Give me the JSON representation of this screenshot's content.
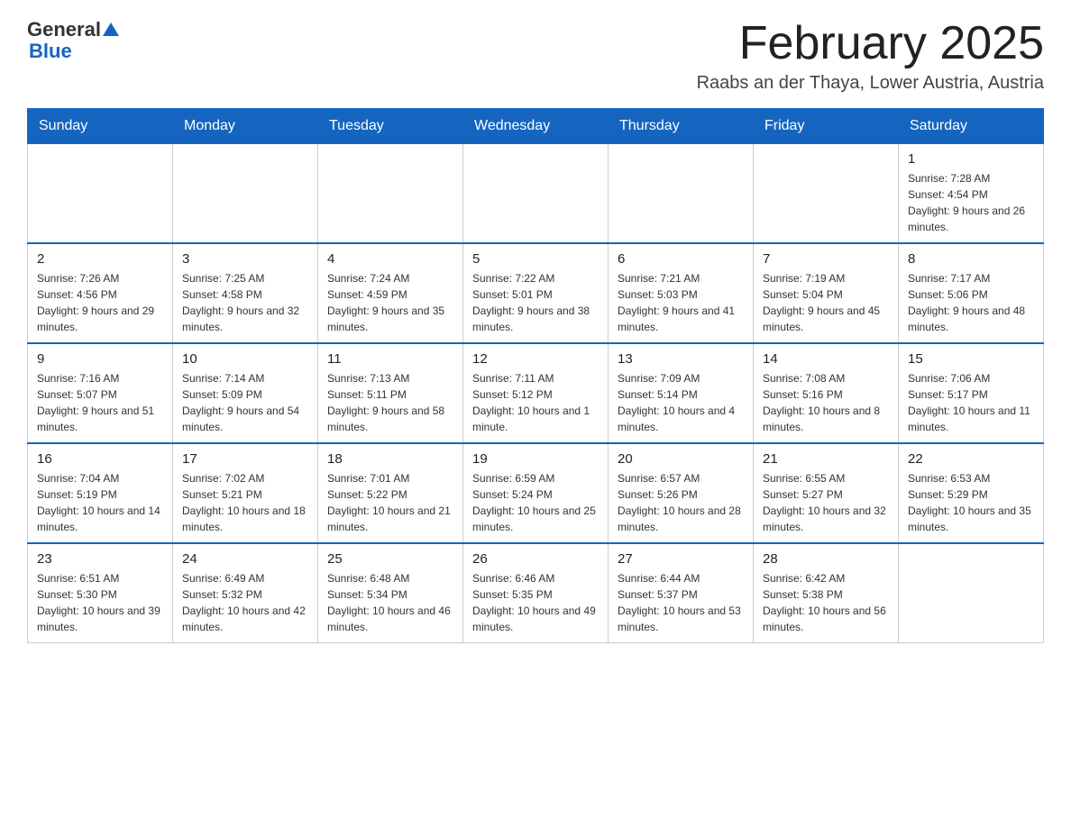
{
  "header": {
    "logo_general": "General",
    "logo_blue": "Blue",
    "title": "February 2025",
    "subtitle": "Raabs an der Thaya, Lower Austria, Austria"
  },
  "weekdays": [
    "Sunday",
    "Monday",
    "Tuesday",
    "Wednesday",
    "Thursday",
    "Friday",
    "Saturday"
  ],
  "weeks": [
    [
      {
        "day": "",
        "info": ""
      },
      {
        "day": "",
        "info": ""
      },
      {
        "day": "",
        "info": ""
      },
      {
        "day": "",
        "info": ""
      },
      {
        "day": "",
        "info": ""
      },
      {
        "day": "",
        "info": ""
      },
      {
        "day": "1",
        "info": "Sunrise: 7:28 AM\nSunset: 4:54 PM\nDaylight: 9 hours and 26 minutes."
      }
    ],
    [
      {
        "day": "2",
        "info": "Sunrise: 7:26 AM\nSunset: 4:56 PM\nDaylight: 9 hours and 29 minutes."
      },
      {
        "day": "3",
        "info": "Sunrise: 7:25 AM\nSunset: 4:58 PM\nDaylight: 9 hours and 32 minutes."
      },
      {
        "day": "4",
        "info": "Sunrise: 7:24 AM\nSunset: 4:59 PM\nDaylight: 9 hours and 35 minutes."
      },
      {
        "day": "5",
        "info": "Sunrise: 7:22 AM\nSunset: 5:01 PM\nDaylight: 9 hours and 38 minutes."
      },
      {
        "day": "6",
        "info": "Sunrise: 7:21 AM\nSunset: 5:03 PM\nDaylight: 9 hours and 41 minutes."
      },
      {
        "day": "7",
        "info": "Sunrise: 7:19 AM\nSunset: 5:04 PM\nDaylight: 9 hours and 45 minutes."
      },
      {
        "day": "8",
        "info": "Sunrise: 7:17 AM\nSunset: 5:06 PM\nDaylight: 9 hours and 48 minutes."
      }
    ],
    [
      {
        "day": "9",
        "info": "Sunrise: 7:16 AM\nSunset: 5:07 PM\nDaylight: 9 hours and 51 minutes."
      },
      {
        "day": "10",
        "info": "Sunrise: 7:14 AM\nSunset: 5:09 PM\nDaylight: 9 hours and 54 minutes."
      },
      {
        "day": "11",
        "info": "Sunrise: 7:13 AM\nSunset: 5:11 PM\nDaylight: 9 hours and 58 minutes."
      },
      {
        "day": "12",
        "info": "Sunrise: 7:11 AM\nSunset: 5:12 PM\nDaylight: 10 hours and 1 minute."
      },
      {
        "day": "13",
        "info": "Sunrise: 7:09 AM\nSunset: 5:14 PM\nDaylight: 10 hours and 4 minutes."
      },
      {
        "day": "14",
        "info": "Sunrise: 7:08 AM\nSunset: 5:16 PM\nDaylight: 10 hours and 8 minutes."
      },
      {
        "day": "15",
        "info": "Sunrise: 7:06 AM\nSunset: 5:17 PM\nDaylight: 10 hours and 11 minutes."
      }
    ],
    [
      {
        "day": "16",
        "info": "Sunrise: 7:04 AM\nSunset: 5:19 PM\nDaylight: 10 hours and 14 minutes."
      },
      {
        "day": "17",
        "info": "Sunrise: 7:02 AM\nSunset: 5:21 PM\nDaylight: 10 hours and 18 minutes."
      },
      {
        "day": "18",
        "info": "Sunrise: 7:01 AM\nSunset: 5:22 PM\nDaylight: 10 hours and 21 minutes."
      },
      {
        "day": "19",
        "info": "Sunrise: 6:59 AM\nSunset: 5:24 PM\nDaylight: 10 hours and 25 minutes."
      },
      {
        "day": "20",
        "info": "Sunrise: 6:57 AM\nSunset: 5:26 PM\nDaylight: 10 hours and 28 minutes."
      },
      {
        "day": "21",
        "info": "Sunrise: 6:55 AM\nSunset: 5:27 PM\nDaylight: 10 hours and 32 minutes."
      },
      {
        "day": "22",
        "info": "Sunrise: 6:53 AM\nSunset: 5:29 PM\nDaylight: 10 hours and 35 minutes."
      }
    ],
    [
      {
        "day": "23",
        "info": "Sunrise: 6:51 AM\nSunset: 5:30 PM\nDaylight: 10 hours and 39 minutes."
      },
      {
        "day": "24",
        "info": "Sunrise: 6:49 AM\nSunset: 5:32 PM\nDaylight: 10 hours and 42 minutes."
      },
      {
        "day": "25",
        "info": "Sunrise: 6:48 AM\nSunset: 5:34 PM\nDaylight: 10 hours and 46 minutes."
      },
      {
        "day": "26",
        "info": "Sunrise: 6:46 AM\nSunset: 5:35 PM\nDaylight: 10 hours and 49 minutes."
      },
      {
        "day": "27",
        "info": "Sunrise: 6:44 AM\nSunset: 5:37 PM\nDaylight: 10 hours and 53 minutes."
      },
      {
        "day": "28",
        "info": "Sunrise: 6:42 AM\nSunset: 5:38 PM\nDaylight: 10 hours and 56 minutes."
      },
      {
        "day": "",
        "info": ""
      }
    ]
  ]
}
